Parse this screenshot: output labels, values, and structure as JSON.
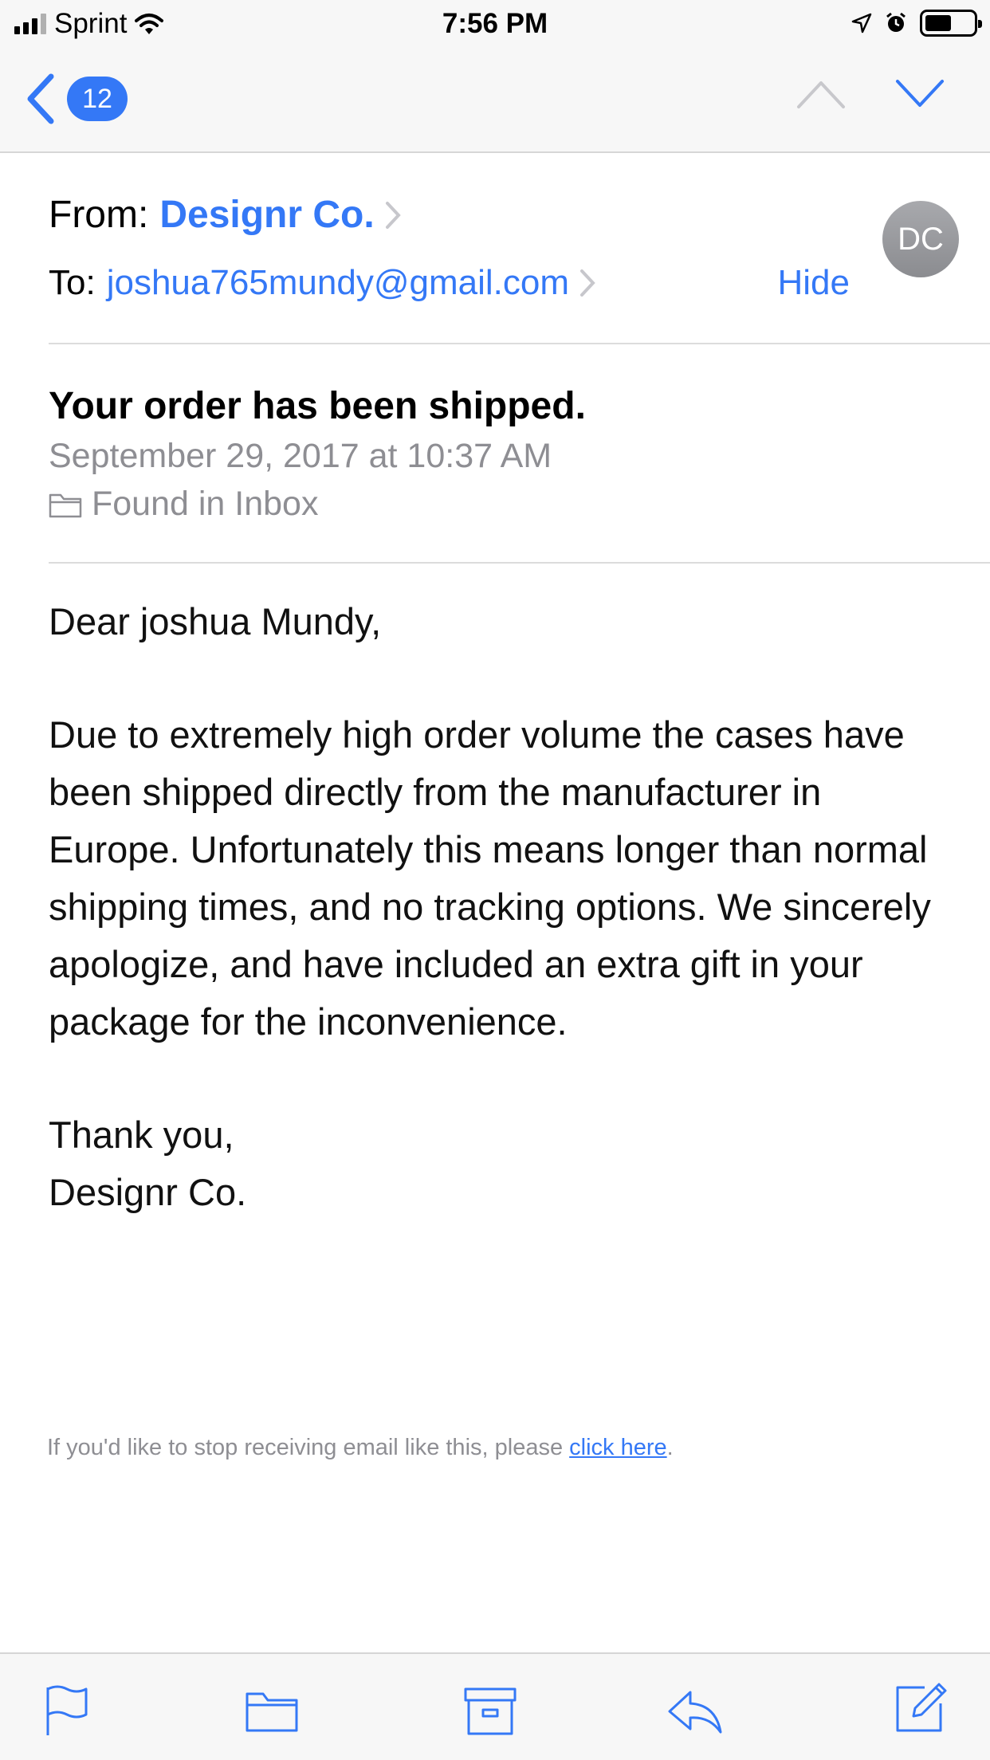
{
  "status_bar": {
    "carrier": "Sprint",
    "time": "7:56 PM",
    "battery_level": 0.55
  },
  "nav": {
    "unread_count": "12",
    "icons": [
      "back-chevron-icon",
      "previous-message-icon",
      "next-message-icon"
    ]
  },
  "header": {
    "from_label": "From:",
    "sender": "Designr Co.",
    "to_label": "To:",
    "recipient": "joshua765mundy@gmail.com",
    "hide_label": "Hide",
    "avatar_initials": "DC"
  },
  "message": {
    "subject": "Your order has been shipped.",
    "date": "September 29, 2017 at 10:37 AM",
    "mailbox": "Found in Inbox",
    "greeting": "Dear joshua Mundy,",
    "body": "Due to extremely high order volume the cases have been shipped directly from the manufacturer in Europe. Unfortunately this means longer than normal shipping times, and no tracking options. We sincerely apologize, and have included an extra gift in your package for the inconvenience.",
    "signoff_line1": "Thank you,",
    "signoff_line2": "Designr Co.",
    "unsubscribe_text": "If you'd like to stop receiving email like this, please ",
    "unsubscribe_link": "click here",
    "unsubscribe_end": "."
  },
  "toolbar": {
    "icons": [
      "flag-icon",
      "folder-icon",
      "archive-icon",
      "reply-icon",
      "compose-icon"
    ]
  },
  "colors": {
    "accent": "#3478f6",
    "secondary_text": "#8e8e93",
    "bar_background": "#f7f7f7"
  }
}
